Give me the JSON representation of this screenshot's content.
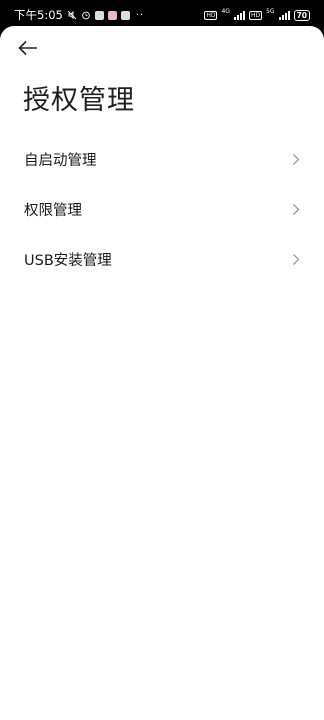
{
  "status_bar": {
    "time": "下午5:05",
    "network_1": "4G",
    "network_2": "5G",
    "hd_1": "HD",
    "hd_2": "HD",
    "battery": "70",
    "icons": [
      "mute-icon",
      "alarm-icon",
      "app-icon",
      "app-icon",
      "app-icon",
      "more-dots-icon",
      "signal-icon",
      "battery-icon"
    ]
  },
  "header": {
    "back_icon": "arrow-left-icon",
    "title": "授权管理"
  },
  "menu": {
    "items": [
      {
        "label": "自启动管理",
        "icon": "chevron-right-icon"
      },
      {
        "label": "权限管理",
        "icon": "chevron-right-icon"
      },
      {
        "label": "USB安装管理",
        "icon": "chevron-right-icon"
      }
    ]
  },
  "colors": {
    "background": "#ffffff",
    "status_bar": "#000000",
    "text_primary": "#1a1a1a",
    "chevron": "#9a9a9a"
  }
}
